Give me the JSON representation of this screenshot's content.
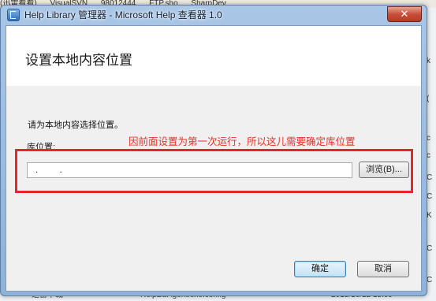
{
  "background": {
    "top_strip": [
      "(迅雷看看)",
      "VisualSVN",
      "98012444",
      "FTP.sho",
      "SharpDev"
    ],
    "right_edge": [
      "k",
      "(",
      "c",
      "c",
      "C",
      "C",
      "K",
      "C",
      "C"
    ],
    "bottom": {
      "left": "迅雷下载",
      "file": "HelpLibAgent.exe.config",
      "date": "2015/10/12 15:09",
      "right": "CONF"
    }
  },
  "window": {
    "title": "Help Library 管理器 - Microsoft Help 查看器 1.0",
    "close_glyph": "✕"
  },
  "dialog": {
    "heading": "设置本地内容位置",
    "instruction": "请为本地内容选择位置。",
    "library_label": "库位置:",
    "annotation": "因前面设置为第一次运行，所以这儿需要确定库位置",
    "path_value": "  .         .",
    "browse_label": "浏览(B)...",
    "ok_label": "确定",
    "cancel_label": "取消"
  },
  "colors": {
    "annotation": "#e8312a",
    "highlight_box": "#e2262a",
    "titlebar": "#a9c6e6"
  },
  "icons": {
    "app": "help-library-icon",
    "close": "close-icon"
  }
}
